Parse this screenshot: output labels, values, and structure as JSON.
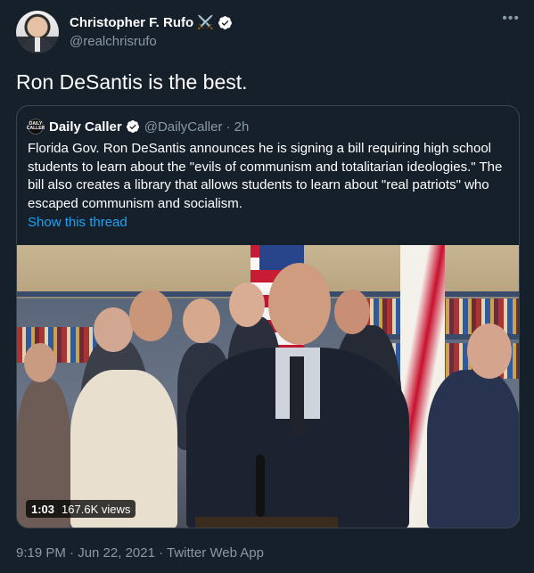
{
  "tweet": {
    "author_name": "Christopher F. Rufo",
    "author_emoji": "⚔️",
    "author_handle": "@realchrisrufo",
    "text": "Ron DeSantis is the best.",
    "timestamp": "9:19 PM · Jun 22, 2021",
    "source": "Twitter Web App",
    "more_icon": "more-icon",
    "verified_icon": "verified-icon"
  },
  "quote": {
    "name": "Daily Caller",
    "handle": "@DailyCaller",
    "time": "· 2h",
    "logo_text": "DAILY CALLER",
    "body": "Florida Gov. Ron DeSantis announces he is signing a bill requiring high school students to learn about the \"evils of communism and totalitarian ideologies.\" The bill also creates a library that allows students to learn about \"real patriots\" who escaped communism and socialism.",
    "show_thread": "Show this thread",
    "media": {
      "duration": "1:03",
      "views": "167.6K views"
    }
  },
  "colors": {
    "background": "#15202b",
    "text_primary": "#ffffff",
    "text_secondary": "#8899a6",
    "link": "#1da1f2",
    "border": "#38444d",
    "verified": "#1da1f2"
  }
}
